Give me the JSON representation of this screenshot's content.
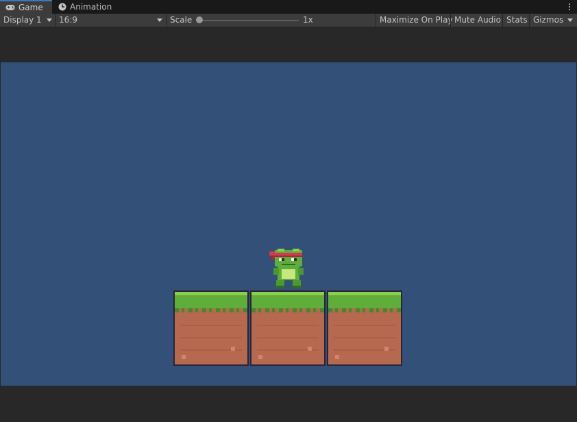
{
  "tabs": [
    {
      "label": "Game",
      "icon": "gamepad-icon",
      "active": true
    },
    {
      "label": "Animation",
      "icon": "clock-icon",
      "active": false
    }
  ],
  "toolbar": {
    "display": "Display 1",
    "aspect": "16:9",
    "scale_label": "Scale",
    "scale_value": "1x",
    "scale_fraction": 0.0,
    "maximize": "Maximize On Play",
    "mute": "Mute Audio",
    "stats": "Stats",
    "gizmos": "Gizmos"
  },
  "colors": {
    "scene_background": "#335078",
    "grass": "#5fae39",
    "dirt": "#b6694f",
    "editor_background": "#282828",
    "tab_accent": "#3a79bb"
  },
  "scene": {
    "player": "frog-character-with-red-headband",
    "tiles": [
      "grass-dirt-tile",
      "grass-dirt-tile",
      "grass-dirt-tile"
    ]
  }
}
